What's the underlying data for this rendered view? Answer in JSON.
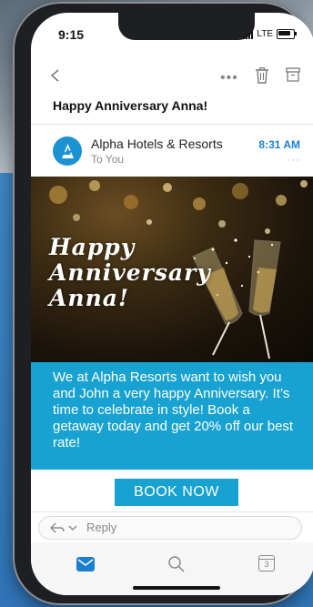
{
  "status": {
    "time": "9:15",
    "network": "LTE"
  },
  "toolbar": {
    "more": "•••"
  },
  "email": {
    "subject": "Happy Anniversary Anna!",
    "sender": "Alpha Hotels & Resorts",
    "to": "To You",
    "time": "8:31 AM",
    "sender_more": "···"
  },
  "banner": {
    "line1": "Happy",
    "line2": "Anniversary",
    "line3": "Anna!"
  },
  "promo": {
    "text": "We at Alpha Resorts want to wish you and John a very happy Anniversary. It’s time to celebrate in style! Book a getaway today and get 20% off our best rate!"
  },
  "cta": {
    "label": "BOOK NOW"
  },
  "reply": {
    "label": "Reply"
  },
  "tabbar": {
    "calendar_day": "3"
  },
  "colors": {
    "accent": "#17a2d1",
    "link_blue": "#1b7fd0",
    "avatar": "#1b92d2"
  },
  "icons": [
    "back-icon",
    "more-icon",
    "trash-icon",
    "archive-icon",
    "avatar-logo-icon",
    "reply-icon",
    "chevron-down-icon",
    "mail-icon",
    "search-icon",
    "calendar-icon"
  ]
}
